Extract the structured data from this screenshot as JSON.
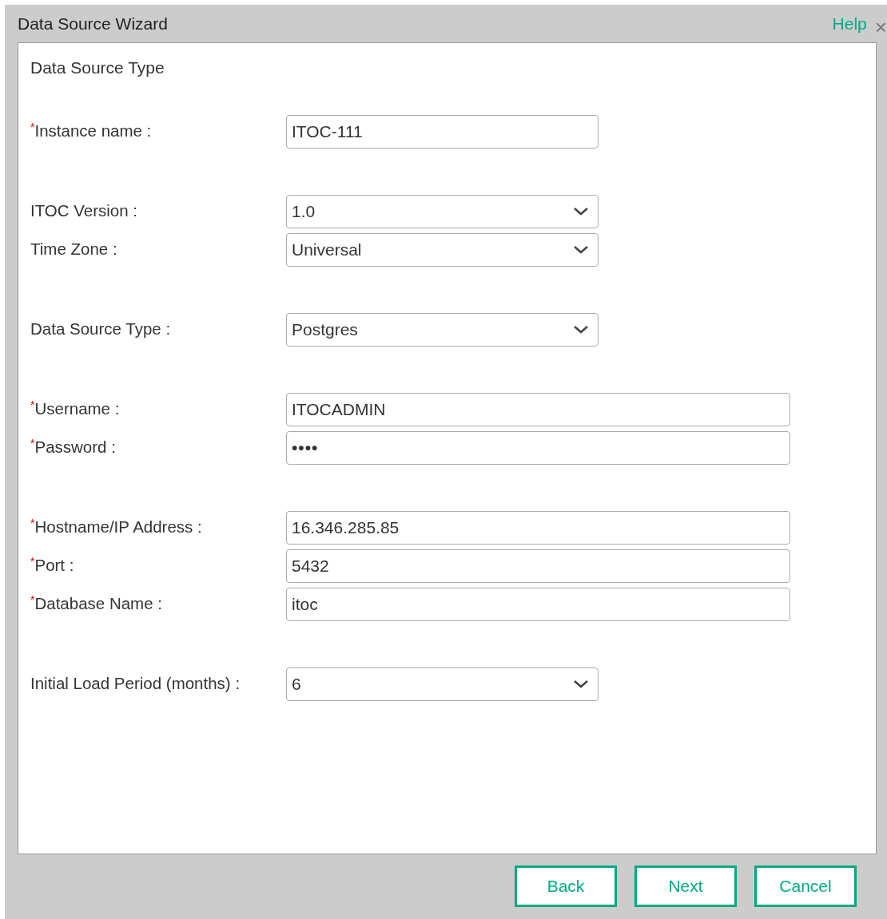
{
  "window": {
    "title": "Data Source Wizard",
    "help_link": "Help",
    "close": "×"
  },
  "panel": {
    "heading": "Data Source Type"
  },
  "field_groups": [
    [
      {
        "required_mark": "*",
        "label": "Instance name :",
        "kind": "text",
        "value": "ITOC-111"
      }
    ],
    [
      {
        "label": "ITOC Version :",
        "kind": "select",
        "value": "1.0"
      },
      {
        "label": "Time Zone :",
        "kind": "select",
        "value": "Universal"
      }
    ],
    [
      {
        "label": "Data Source Type :",
        "kind": "select",
        "value": "Postgres"
      }
    ],
    [
      {
        "required_mark": "*",
        "label": "Username :",
        "kind": "text",
        "value": "ITOCADMIN"
      },
      {
        "required_mark": "*",
        "label": "Password :",
        "kind": "password",
        "value": "••••"
      }
    ],
    [
      {
        "required_mark": "*",
        "label": "Hostname/IP Address :",
        "kind": "text",
        "value": "16.346.285.85"
      },
      {
        "required_mark": "*",
        "label": "Port :",
        "kind": "text",
        "value": "5432"
      },
      {
        "required_mark": "*",
        "label": "Database Name :",
        "kind": "text",
        "value": "itoc"
      }
    ],
    [
      {
        "label": "Initial Load Period (months) :",
        "kind": "select",
        "value": "6"
      }
    ]
  ],
  "buttons": [
    "Back",
    "Next",
    "Cancel"
  ]
}
